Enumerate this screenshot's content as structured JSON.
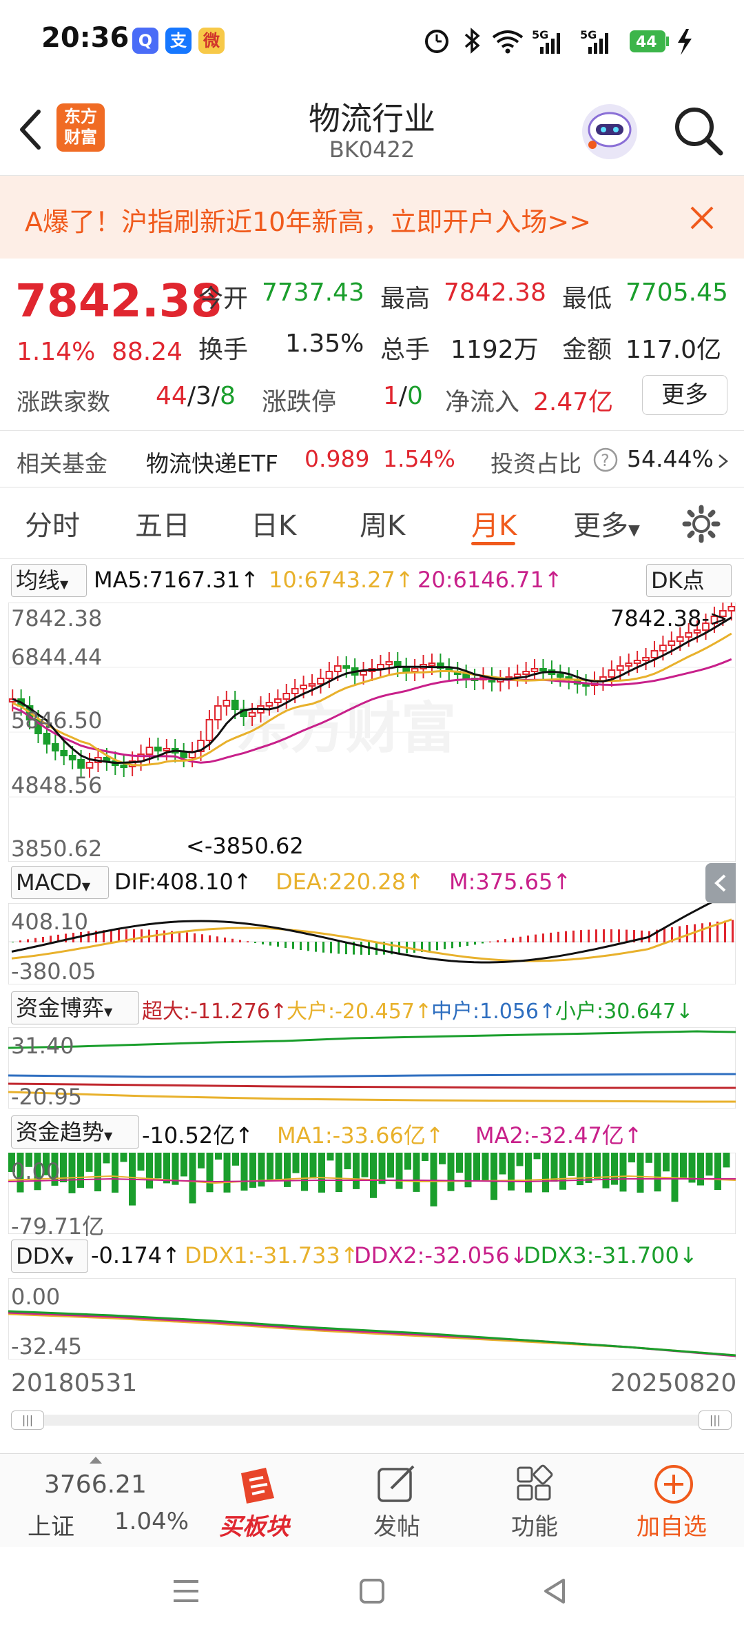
{
  "status": {
    "time": "20:36",
    "apps": [
      "Q",
      "支",
      "微"
    ],
    "battery": "44",
    "network": "5G"
  },
  "header": {
    "title": "物流行业",
    "code": "BK0422",
    "logo_line1": "东方",
    "logo_line2": "财富"
  },
  "promo": {
    "text": "A爆了！沪指刷新近10年新高，立即开户入场>>"
  },
  "quote": {
    "price": "7842.38",
    "change_pct": "1.14%",
    "change": "88.24",
    "open_label": "今开",
    "open": "7737.43",
    "high_label": "最高",
    "high": "7842.38",
    "low_label": "最低",
    "low": "7705.45",
    "turnover_label": "换手",
    "turnover": "1.35%",
    "volume_label": "总手",
    "volume": "1192万",
    "amount_label": "金额",
    "amount": "117.0亿",
    "adv_label": "涨跌家数",
    "adv_up": "44",
    "adv_flat": "3",
    "adv_down": "8",
    "limit_label": "涨跌停",
    "limit_up": "1",
    "limit_down": "0",
    "inflow_label": "净流入",
    "inflow": "2.47亿",
    "more_button": "更多"
  },
  "fund": {
    "label": "相关基金",
    "name": "物流快递ETF",
    "price": "0.989",
    "pct": "1.54%",
    "ratio_label": "投资占比",
    "ratio": "54.44%"
  },
  "tabs": [
    "分时",
    "五日",
    "日K",
    "周K",
    "月K",
    "更多"
  ],
  "active_tab": "月K",
  "ma": {
    "select": "均线",
    "ma5": "MA5:7167.31↑",
    "ma10": "10:6743.27↑",
    "ma20": "20:6146.71↑",
    "dk_button": "DK点"
  },
  "kline_axis": {
    "top": "7842.38",
    "mid1": "6844.44",
    "mid2": "5846.50",
    "mid3": "4848.56",
    "bottom": "3850.62",
    "max_marker": "7842.38->",
    "min_marker": "<-3850.62"
  },
  "macd": {
    "select": "MACD",
    "dif": "DIF:408.10↑",
    "dea": "DEA:220.28↑",
    "m": "M:375.65↑",
    "axis_top": "408.10",
    "axis_bottom": "-380.05"
  },
  "fund_game": {
    "select": "资金博弈",
    "super": "超大:-11.276↑",
    "large": "大户:-20.457↑",
    "mid": "中户:1.056↑",
    "small": "小户:30.647↓",
    "axis_top": "31.40",
    "axis_bottom": "-20.95"
  },
  "fund_trend": {
    "select": "资金趋势",
    "value": "-10.52亿↑",
    "ma1": "MA1:-33.66亿↑",
    "ma2": "MA2:-32.47亿↑",
    "axis_top": "0.00",
    "axis_bottom": "-79.71亿"
  },
  "ddx": {
    "select": "DDX",
    "value": "-0.174↑",
    "ddx1": "DDX1:-31.733↑",
    "ddx2": "DDX2:-32.056↓",
    "ddx3": "DDX3:-31.700↓",
    "axis_top": "0.00",
    "axis_bottom": "-32.45"
  },
  "dates": {
    "start": "20180531",
    "end": "20250820"
  },
  "toolbar": {
    "index_value": "3766.21",
    "index_name": "上证",
    "index_pct": "1.04%",
    "buy_label": "买板块",
    "post_label": "发帖",
    "func_label": "功能",
    "add_label": "加自选"
  },
  "colors": {
    "up": "#e0262f",
    "down": "#1a9e2c",
    "accent": "#f05a1c",
    "ma5": "#111111",
    "ma10": "#e8b12c",
    "ma20": "#c8208a"
  }
}
